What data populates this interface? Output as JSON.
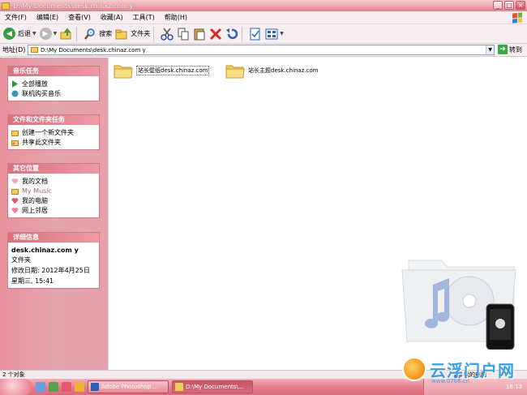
{
  "window": {
    "title": "D:\\My Documents\\desk.chinaz.com y",
    "buttons": [
      "_",
      "□",
      "×"
    ]
  },
  "menu": {
    "items": [
      "文件(F)",
      "编辑(E)",
      "查看(V)",
      "收藏(A)",
      "工具(T)",
      "帮助(H)"
    ]
  },
  "toolbar": {
    "back_label": "后退",
    "search_label": "搜索",
    "folders_label": "文件夹"
  },
  "address": {
    "label": "地址(D)",
    "value": "D:\\My Documents\\desk.chinaz.com y",
    "go_label": "转到"
  },
  "sidebar": {
    "music_tasks": {
      "header": "音乐任务",
      "items": [
        "全部播放",
        "联机购买音乐"
      ]
    },
    "file_tasks": {
      "header": "文件和文件夹任务",
      "items": [
        "创建一个新文件夹",
        "共享此文件夹"
      ]
    },
    "other_places": {
      "header": "其它位置",
      "items": [
        "我的文档",
        "My Music",
        "我的电脑",
        "网上邻居"
      ]
    },
    "details": {
      "header": "详细信息",
      "name": "desk.chinaz.com y",
      "type": "文件夹",
      "modified_line1": "修改日期: 2012年4月25日",
      "modified_line2": "星期三, 15:41"
    }
  },
  "files": [
    {
      "name": "站长壁纸desk.chinaz.com"
    },
    {
      "name": "站长主题desk.chinaz.com"
    }
  ],
  "status": {
    "left": "2 个对象",
    "right": "我的电脑"
  },
  "taskbar": {
    "tasks": [
      "Adobe Photoshop ...",
      "D:\\My Documents\\..."
    ],
    "clock": "16:13"
  },
  "brand": {
    "name": "云浮门户网",
    "url": "www.0766.cn"
  },
  "colors": {
    "accent": "#e2a4ad",
    "panel_header": "#d9707f",
    "brand_blue": "#3aa0e0"
  }
}
